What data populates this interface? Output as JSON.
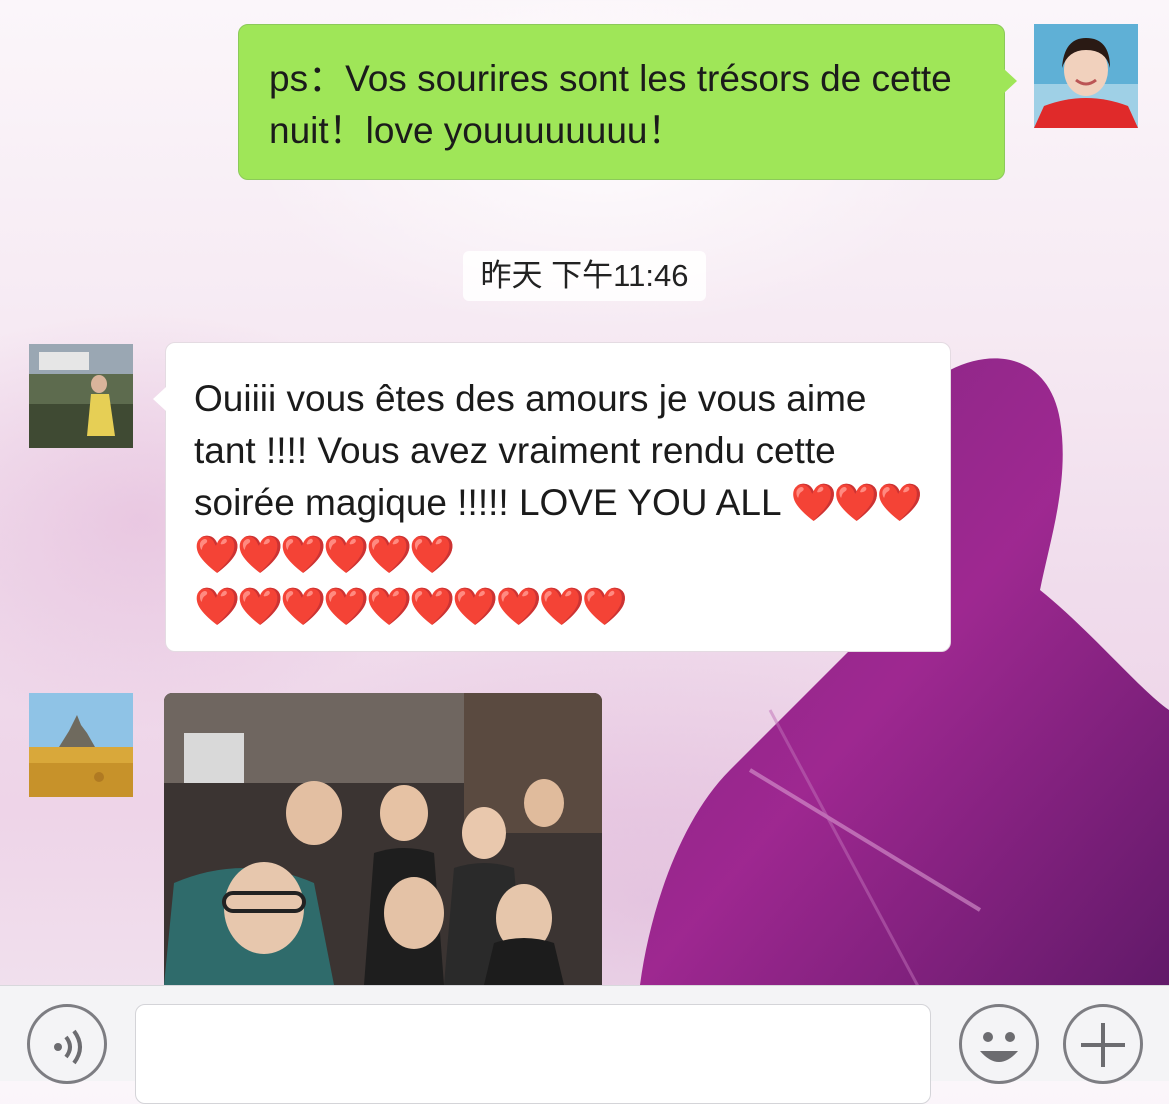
{
  "messages": {
    "outgoing_text": "ps：Vos sourires sont les trésors de cette nuit！love youuuuuuuu！",
    "timestamp": "昨天 下午11:46",
    "incoming_text": "Ouiiii vous êtes des amours je vous aime tant !!!! Vous avez vraiment rendu cette soirée magique !!!!! LOVE YOU ALL",
    "hearts_line1": "❤️❤️❤️❤️❤️❤️❤️❤️❤️",
    "hearts_line2": "❤️❤️❤️❤️❤️❤️❤️❤️❤️❤️"
  },
  "icons": {
    "voice": "voice-icon",
    "emoji": "emoji-icon",
    "add": "plus-icon"
  },
  "colors": {
    "outgoing_bubble": "#9fe658",
    "incoming_bubble": "#ffffff",
    "heart": "#e0202a"
  }
}
